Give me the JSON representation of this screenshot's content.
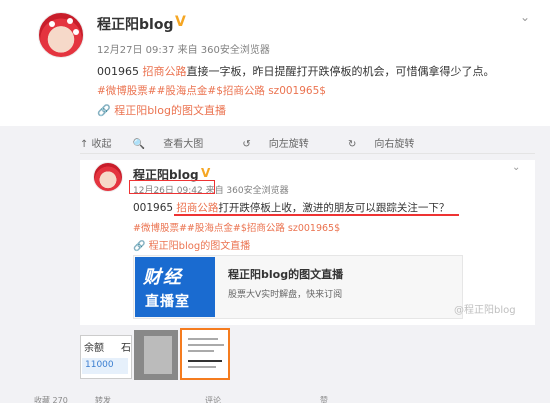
{
  "post": {
    "author": "程正阳blog",
    "verified_badge": "V",
    "meta": "12月27日 09:37 来自 360安全浏览器",
    "text_prefix": "001965 ",
    "text_highlight": "招商公路",
    "text_suffix": "直接一字板，昨日提醒打开跌停板的机会，可惜偶拿得少了点。",
    "tags": "#微博股票##股海点金#$招商公路 sz001965$",
    "source": "程正阳blog的图文直播"
  },
  "toolbar": {
    "collapse": "↑ 收起",
    "view_large": "查看大图",
    "rotate_left": "向左旋转",
    "rotate_right": "向右旋转"
  },
  "screenshot": {
    "author": "程正阳blog",
    "verified_badge": "V",
    "meta": "12月26日 09:42 来自 360安全浏览器",
    "text_prefix": "001965 ",
    "text_highlight": "招商公路",
    "text_suffix": "打开跌停板上收，激进的朋友可以跟踪关注一下？",
    "tags": "#微博股票##股海点金#$招商公路 sz001965$",
    "source": "程正阳blog的图文直播",
    "link_card": {
      "logo_line1": "财经",
      "logo_line2": "直播室",
      "title": "程正阳blog的图文直播",
      "subtitle": "股票大V实时解盘，快来订阅"
    },
    "watermark": "@程正阳blog"
  },
  "thumbnails": {
    "table_header_1": "余额",
    "table_header_2": "石",
    "table_value": "11000"
  },
  "bottom_bar": {
    "item1": "收藏 270",
    "item2": "转发",
    "item3": "评论",
    "item4": "赞"
  },
  "colors": {
    "accent": "#eb7350",
    "verified": "#f5a623",
    "annotation_red": "#e33333",
    "logo_blue": "#1a6bd0"
  }
}
